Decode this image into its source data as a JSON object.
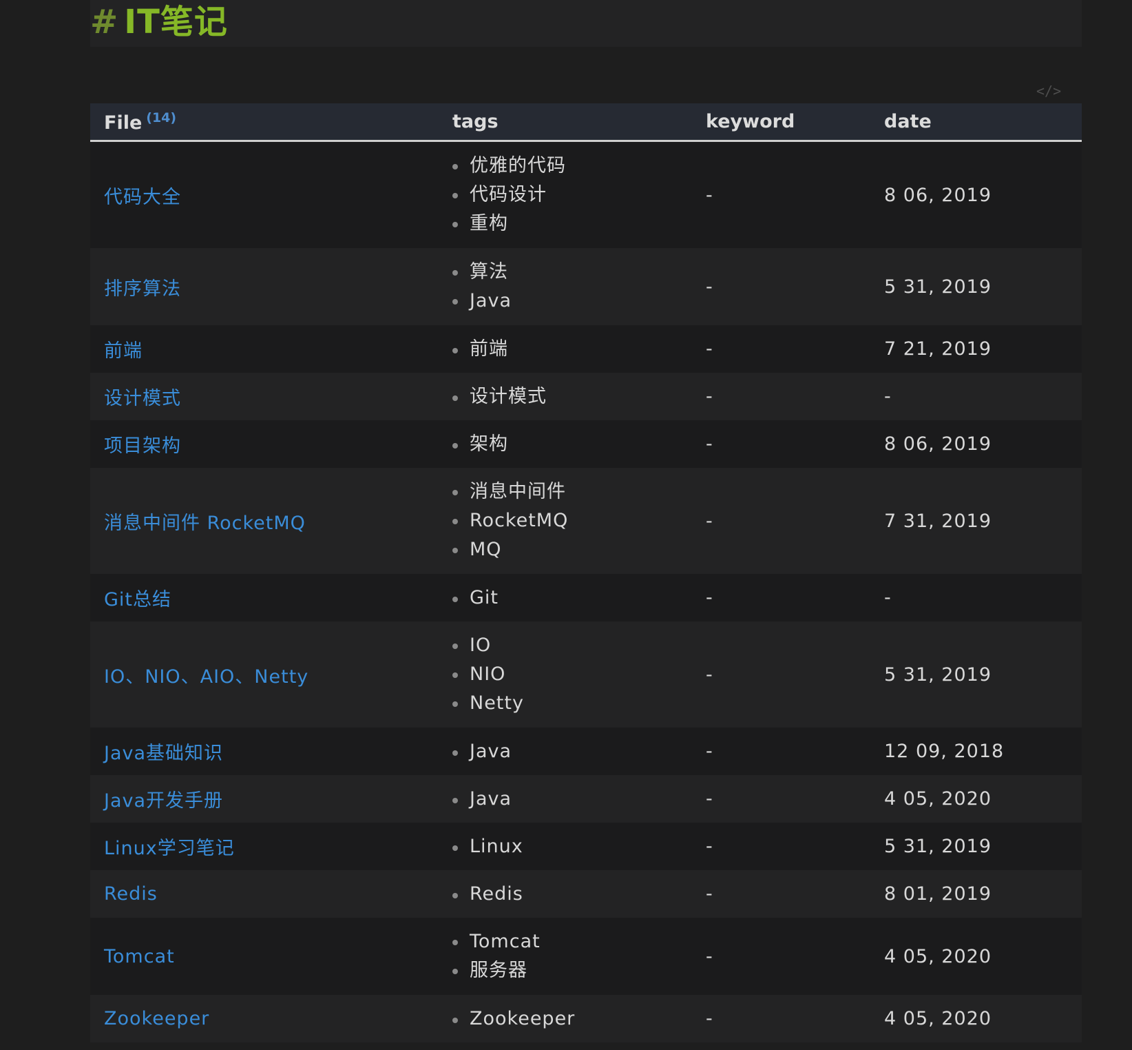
{
  "heading": {
    "hash": "#",
    "title": "IT笔记"
  },
  "code_toggle": "</>",
  "table": {
    "headers": {
      "file": "File",
      "count": "(14)",
      "tags": "tags",
      "keyword": "keyword",
      "date": "date"
    },
    "rows": [
      {
        "file": "代码大全",
        "tags": [
          "优雅的代码",
          "代码设计",
          "重构"
        ],
        "keyword": "-",
        "date": "8 06, 2019"
      },
      {
        "file": "排序算法",
        "tags": [
          "算法",
          "Java"
        ],
        "keyword": "-",
        "date": "5 31, 2019"
      },
      {
        "file": "前端",
        "tags": [
          "前端"
        ],
        "keyword": "-",
        "date": "7 21, 2019"
      },
      {
        "file": "设计模式",
        "tags": [
          "设计模式"
        ],
        "keyword": "-",
        "date": "-"
      },
      {
        "file": "项目架构",
        "tags": [
          "架构"
        ],
        "keyword": "-",
        "date": "8 06, 2019"
      },
      {
        "file": "消息中间件 RocketMQ",
        "tags": [
          "消息中间件",
          "RocketMQ",
          "MQ"
        ],
        "keyword": "-",
        "date": "7 31, 2019"
      },
      {
        "file": "Git总结",
        "tags": [
          "Git"
        ],
        "keyword": "-",
        "date": "-"
      },
      {
        "file": "IO、NIO、AIO、Netty",
        "tags": [
          "IO",
          "NIO",
          "Netty"
        ],
        "keyword": "-",
        "date": "5 31, 2019"
      },
      {
        "file": "Java基础知识",
        "tags": [
          "Java"
        ],
        "keyword": "-",
        "date": "12 09, 2018"
      },
      {
        "file": "Java开发手册",
        "tags": [
          "Java"
        ],
        "keyword": "-",
        "date": "4 05, 2020"
      },
      {
        "file": "Linux学习笔记",
        "tags": [
          "Linux"
        ],
        "keyword": "-",
        "date": "5 31, 2019"
      },
      {
        "file": "Redis",
        "tags": [
          "Redis"
        ],
        "keyword": "-",
        "date": "8 01, 2019"
      },
      {
        "file": "Tomcat",
        "tags": [
          "Tomcat",
          "服务器"
        ],
        "keyword": "-",
        "date": "4 05, 2020"
      },
      {
        "file": "Zookeeper",
        "tags": [
          "Zookeeper"
        ],
        "keyword": "-",
        "date": "4 05, 2020"
      }
    ]
  }
}
